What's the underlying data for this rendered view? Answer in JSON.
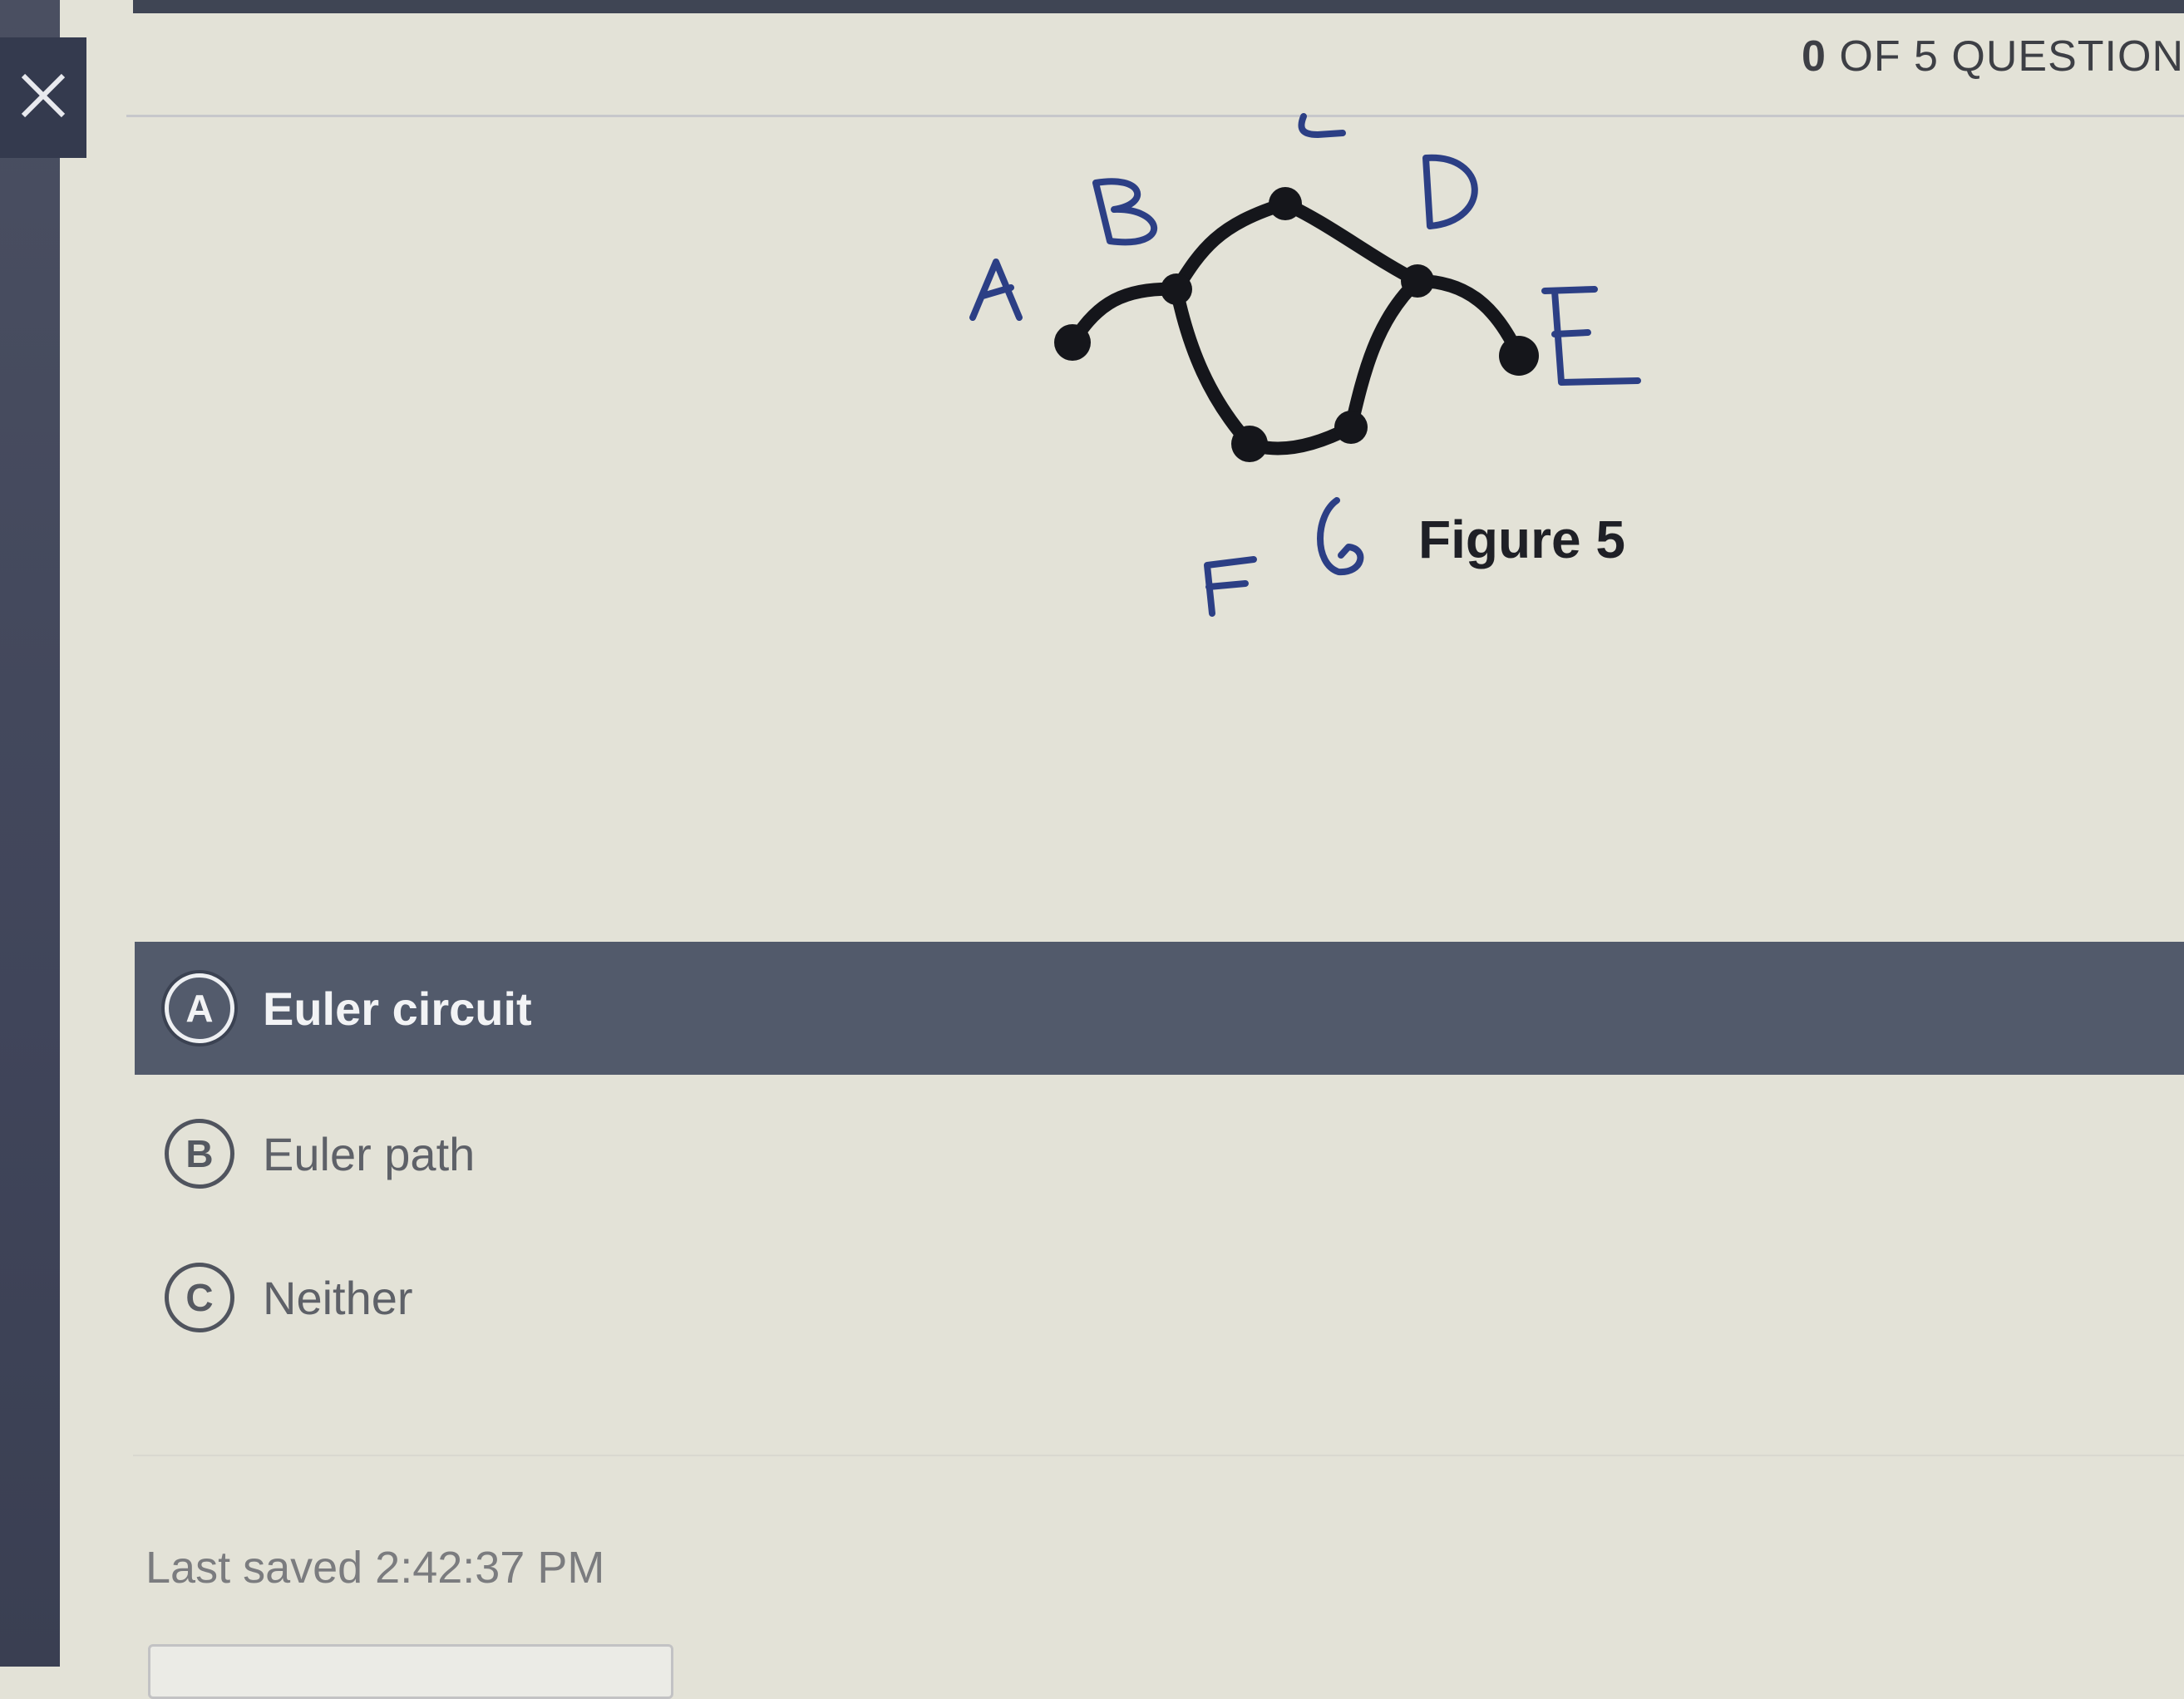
{
  "header": {
    "counter_number": "0",
    "counter_text": "OF 5 QUESTION"
  },
  "figure": {
    "caption": "Figure 5",
    "node_labels": [
      "A",
      "B",
      "C",
      "D",
      "E",
      "F",
      "G"
    ]
  },
  "options": [
    {
      "letter": "A",
      "label": "Euler circuit",
      "selected": true
    },
    {
      "letter": "B",
      "label": "Euler path",
      "selected": false
    },
    {
      "letter": "C",
      "label": "Neither",
      "selected": false
    }
  ],
  "footer": {
    "last_saved": "Last saved 2:42:37 PM"
  },
  "icons": {
    "close": "close-icon"
  },
  "colors": {
    "background": "#e3e2d7",
    "selected_option": "#525a6b",
    "left_rail": "#40455a"
  }
}
